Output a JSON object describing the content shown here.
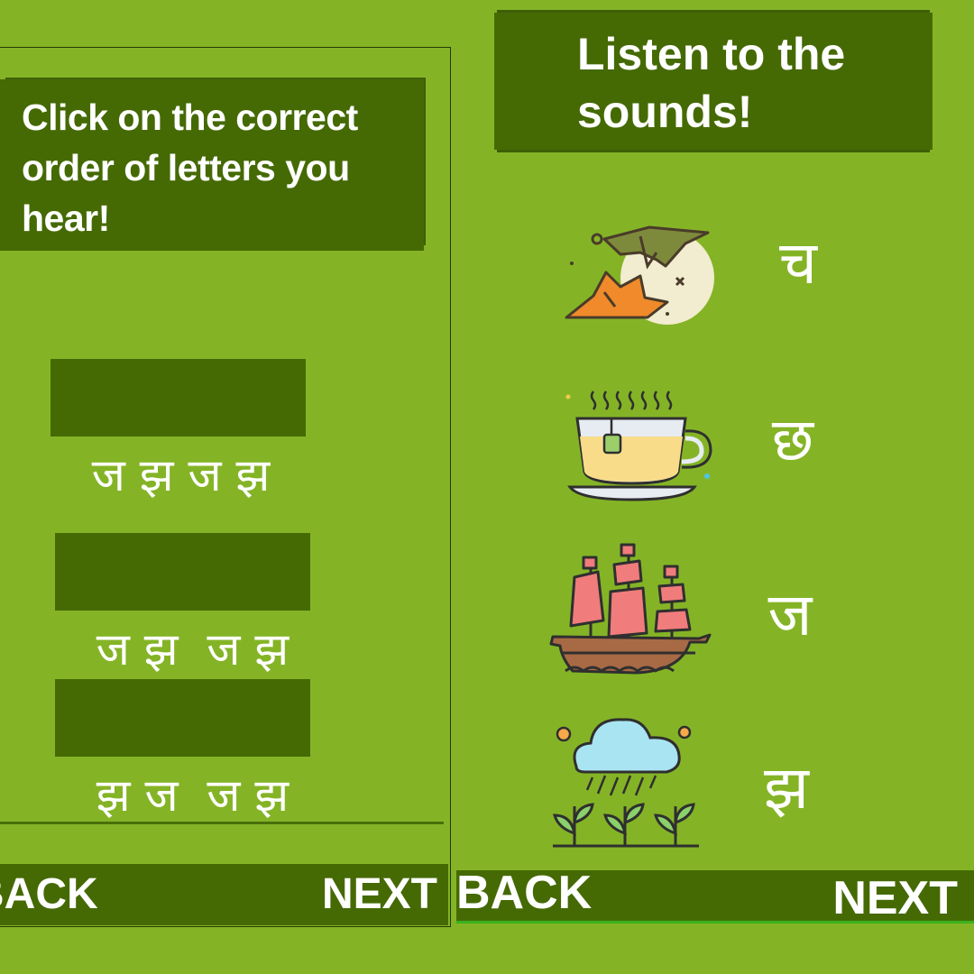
{
  "left_screen": {
    "instruction": "Click on the correct order of letters you hear!",
    "answers": [
      "ज झ ज झ",
      "ज झ  ज झ",
      "झ ज  ज झ"
    ],
    "back_label": "BACK",
    "next_label": "NEXT"
  },
  "right_screen": {
    "title": "Listen to the sounds!",
    "items": [
      {
        "icon": "birds-flying-icon",
        "letter": "च"
      },
      {
        "icon": "tea-cup-icon",
        "letter": "छ"
      },
      {
        "icon": "sailing-ship-icon",
        "letter": "ज"
      },
      {
        "icon": "rain-cloud-plants-icon",
        "letter": "झ"
      }
    ],
    "back_label": "BACK",
    "next_label": "NEXT"
  },
  "colors": {
    "background": "#84b426",
    "panel": "#456a04",
    "text": "#ffffff"
  }
}
